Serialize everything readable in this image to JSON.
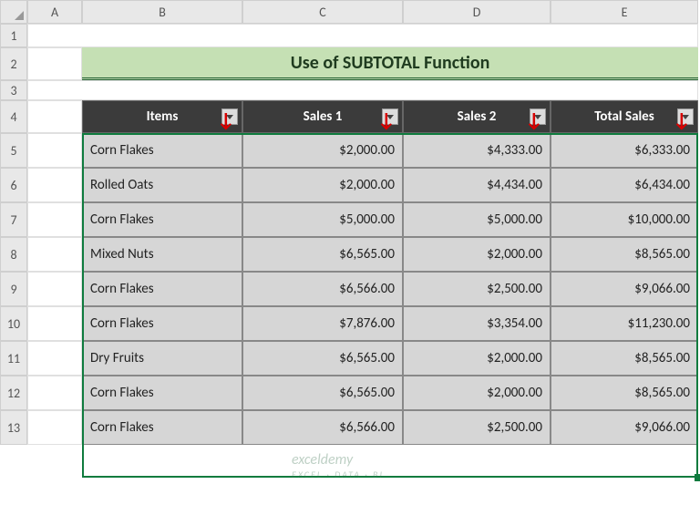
{
  "columns": [
    "A",
    "B",
    "C",
    "D",
    "E"
  ],
  "rows": [
    "1",
    "2",
    "3",
    "4",
    "5",
    "6",
    "7",
    "8",
    "9",
    "10",
    "11",
    "12",
    "13"
  ],
  "title": "Use of SUBTOTAL Function",
  "headers": {
    "items": "Items",
    "sales1": "Sales 1",
    "sales2": "Sales 2",
    "total": "Total Sales"
  },
  "data": [
    {
      "item": "Corn Flakes",
      "s1": "$2,000.00",
      "s2": "$4,333.00",
      "t": "$6,333.00"
    },
    {
      "item": "Rolled Oats",
      "s1": "$2,000.00",
      "s2": "$4,434.00",
      "t": "$6,434.00"
    },
    {
      "item": "Corn Flakes",
      "s1": "$5,000.00",
      "s2": "$5,000.00",
      "t": "$10,000.00"
    },
    {
      "item": "Mixed Nuts",
      "s1": "$6,565.00",
      "s2": "$2,000.00",
      "t": "$8,565.00"
    },
    {
      "item": "Corn Flakes",
      "s1": "$6,566.00",
      "s2": "$2,500.00",
      "t": "$9,066.00"
    },
    {
      "item": "Corn Flakes",
      "s1": "$7,876.00",
      "s2": "$3,354.00",
      "t": "$11,230.00"
    },
    {
      "item": "Dry Fruits",
      "s1": "$6,565.00",
      "s2": "$2,000.00",
      "t": "$8,565.00"
    },
    {
      "item": "Corn Flakes",
      "s1": "$6,565.00",
      "s2": "$2,000.00",
      "t": "$8,565.00"
    },
    {
      "item": "Corn Flakes",
      "s1": "$6,566.00",
      "s2": "$2,500.00",
      "t": "$9,066.00"
    }
  ],
  "watermark": {
    "main": "exceldemy",
    "sub": "EXCEL · DATA · BI"
  },
  "chart_data": {
    "type": "table",
    "title": "Use of SUBTOTAL Function",
    "columns": [
      "Items",
      "Sales 1",
      "Sales 2",
      "Total Sales"
    ],
    "rows": [
      [
        "Corn Flakes",
        2000.0,
        4333.0,
        6333.0
      ],
      [
        "Rolled Oats",
        2000.0,
        4434.0,
        6434.0
      ],
      [
        "Corn Flakes",
        5000.0,
        5000.0,
        10000.0
      ],
      [
        "Mixed Nuts",
        6565.0,
        2000.0,
        8565.0
      ],
      [
        "Corn Flakes",
        6566.0,
        2500.0,
        9066.0
      ],
      [
        "Corn Flakes",
        7876.0,
        3354.0,
        11230.0
      ],
      [
        "Dry Fruits",
        6565.0,
        2000.0,
        8565.0
      ],
      [
        "Corn Flakes",
        6565.0,
        2000.0,
        8565.0
      ],
      [
        "Corn Flakes",
        6566.0,
        2500.0,
        9066.0
      ]
    ]
  }
}
